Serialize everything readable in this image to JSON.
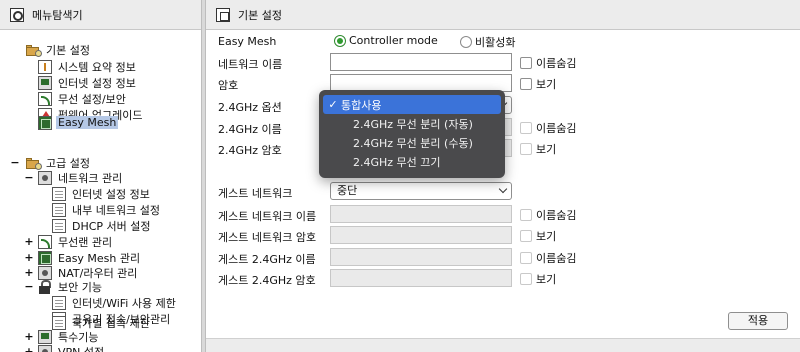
{
  "left_panel": {
    "title": "메뉴탐색기",
    "basic": {
      "label": "기본 설정",
      "items": [
        "시스템 요약 정보",
        "인터넷 설정 정보",
        "무선 설정/보안",
        "펌웨어 업그레이드",
        "Easy Mesh"
      ]
    },
    "advanced": {
      "label": "고급 설정",
      "network": {
        "label": "네트워크 관리",
        "items": [
          "인터넷 설정 정보",
          "내부 네트워크 설정",
          "DHCP 서버 설정"
        ]
      },
      "wireless": "무선랜 관리",
      "mesh": "Easy Mesh 관리",
      "nat": "NAT/라우터 관리",
      "security": {
        "label": "보안 기능",
        "items": [
          "인터넷/WiFi 사용 제한",
          "공유기 접속/보안관리",
          "국가별 접속 제한"
        ]
      },
      "special": "특수기능",
      "vpn": "VPN 설정"
    },
    "expanders": {
      "plus": "+",
      "minus": "−"
    }
  },
  "main": {
    "title": "기본 설정",
    "easy_mesh_label": "Easy Mesh",
    "mode_controller": "Controller mode",
    "mode_disabled": "비활성화",
    "network_name_label": "네트워크 이름",
    "password_label": "암호",
    "option24_label": "2.4GHz 옵션",
    "name24_label": "2.4GHz 이름",
    "pw24_label": "2.4GHz 암호",
    "guest_network_label": "게스트 네트워크",
    "guest_network_value": "중단",
    "guest_name_label": "게스트 네트워크 이름",
    "guest_pw_label": "게스트 네트워크 암호",
    "guest_name24_label": "게스트 2.4GHz 이름",
    "guest_pw24_label": "게스트 2.4GHz 암호",
    "hide_name": "이름숨김",
    "show": "보기",
    "apply_button": "적용"
  },
  "dropdown": {
    "check": "✓",
    "options": [
      "통합사용",
      "2.4GHz 무선 분리 (자동)",
      "2.4GHz 무선 분리 (수동)",
      "2.4GHz 무선 끄기"
    ],
    "selected": "통합사용"
  }
}
